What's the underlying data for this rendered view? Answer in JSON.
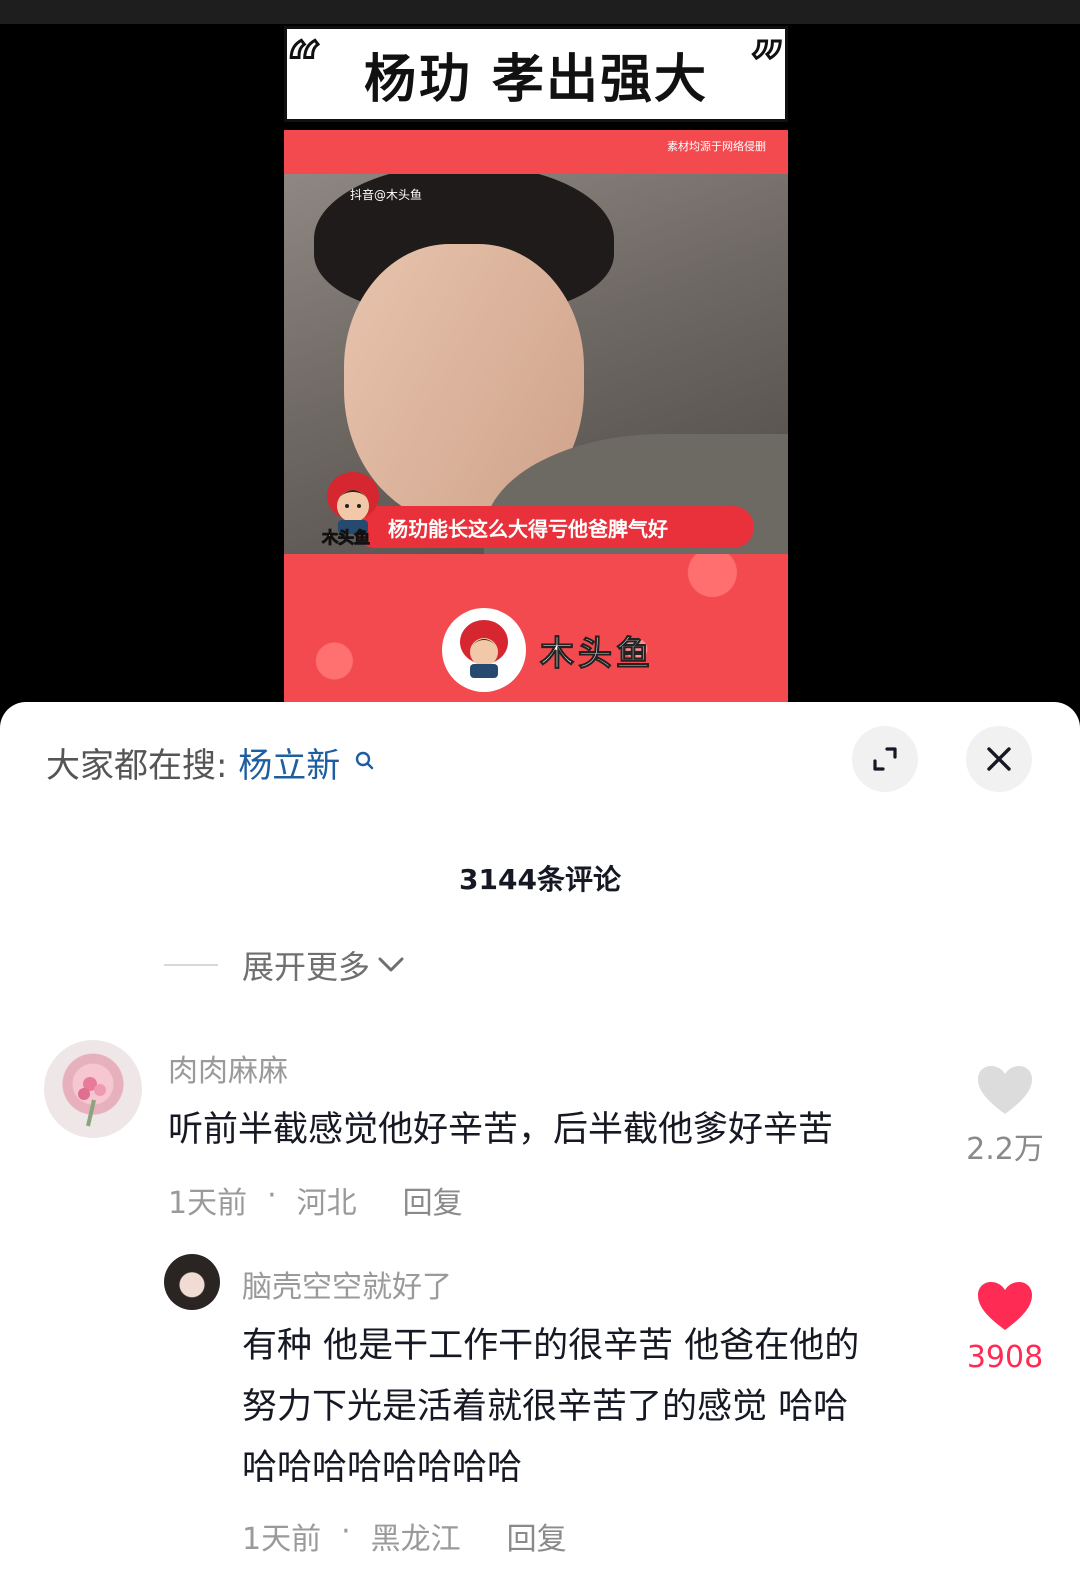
{
  "video": {
    "banner_title": "杨玏 孝出强大",
    "quote_left": "“",
    "quote_right": "”",
    "source_note": "素材均源于网络侵删",
    "douyin_watermark": "抖音@木头鱼",
    "subtitle": "杨玏能长这么大得亏他爸脾气好",
    "mascot_label": "木头鱼",
    "brand_name": "木头鱼"
  },
  "sheet": {
    "search_prefix": "大家都在搜:",
    "search_term": "杨立新",
    "comment_count": "3144条评论",
    "expand_more": "展开更多"
  },
  "comments": [
    {
      "username": "肉肉麻麻",
      "text": "听前半截感觉他好辛苦，后半截他爹好辛苦",
      "time": "1天前",
      "location": "河北",
      "reply": "回复",
      "likes": "2.2万",
      "liked": false
    },
    {
      "username": "脑壳空空就好了",
      "text_lines": [
        "有种 他是干工作干的很辛苦 他爸在他的",
        "努力下光是活着就很辛苦了的感觉 哈哈",
        "哈哈哈哈哈哈哈哈"
      ],
      "time": "1天前",
      "location": "黑龙江",
      "reply": "回复",
      "likes": "3908",
      "liked": true
    }
  ],
  "colors": {
    "accent_red": "#f24a4f",
    "liked_red": "#fe2c55",
    "search_blue": "#1e5d9f"
  }
}
